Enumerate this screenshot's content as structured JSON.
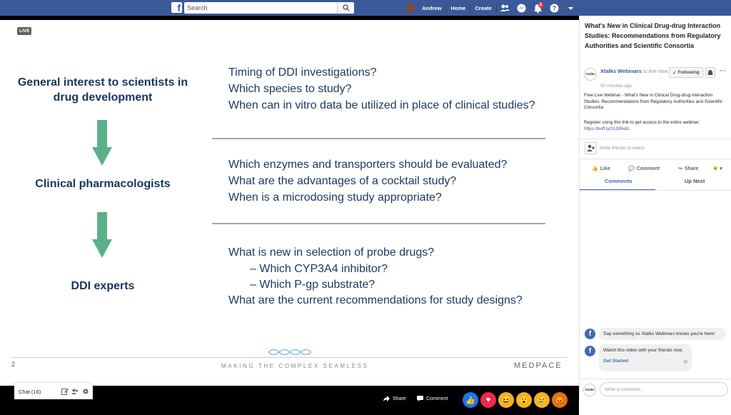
{
  "topbar": {
    "search_placeholder": "Search",
    "user_name": "Andrew",
    "home_label": "Home",
    "create_label": "Create",
    "notification_count": "1"
  },
  "slide": {
    "live_label": "LIVE",
    "left_headings": [
      "General interest to scientists in drug development",
      "Clinical pharmacologists",
      "DDI experts"
    ],
    "section1": [
      "Timing of DDI investigations?",
      "Which species to study?",
      "When can in vitro data be utilized in place of clinical studies?"
    ],
    "section2": [
      "Which enzymes and transporters should be evaluated?",
      "What are the advantages of a cocktail study?",
      "When is a microdosing study appropriate?"
    ],
    "section3": [
      "What is new in selection of probe drugs?",
      "– Which CYP3A4 inhibitor?",
      "– Which P-gp substrate?",
      "What are the current recommendations for study designs?"
    ],
    "page_number": "2",
    "tagline": "MAKING THE COMPLEX SEAMLESS",
    "brand": "MEDPACE",
    "accent_color": "#5bb08a",
    "text_color": "#1f3864"
  },
  "videobar": {
    "share_label": "Share",
    "comment_label": "Comment",
    "reactions": [
      "like",
      "love",
      "haha",
      "wow",
      "sad",
      "angry"
    ]
  },
  "chat": {
    "label": "Chat (16)"
  },
  "panel": {
    "title": "What's New in Clinical Drug-drug Interaction Studies: Recommendations from Regulatory Authorities and Scientific Consortia",
    "author": "Xtalks Webinars",
    "author_suffix": " is live now.",
    "time": "50 minutes ago ·",
    "follow_label": "Following",
    "description": "Free Live Webinar - What's New in Clinical Drug-drug Interaction Studies: Recommendations from Regulatory Authorities and Scientific Consortia",
    "register_text": "Register using this link to get access to the entire webinar:",
    "register_link": "https://buff.ly/31GRxdL",
    "invite_text": "Invite friends to watch",
    "like_label": "Like",
    "comment_label": "Comment",
    "share_label": "Share",
    "tab_comments": "Comments",
    "tab_upnext": "Up Next",
    "msg1": "Say something so Xtalks Webinars knows you're here!",
    "msg2": "Watch this video with your friends now.",
    "msg2_link": "Get Started",
    "comment_placeholder": "Write a comment...",
    "avatar_text": "Xtalks",
    "link_color": "#365899"
  }
}
